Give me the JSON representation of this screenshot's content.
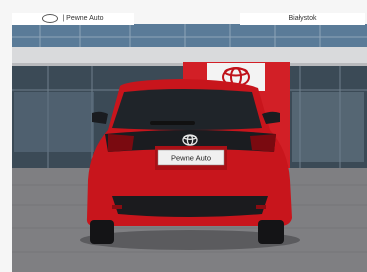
{
  "banners": {
    "left": "| Pewne Auto",
    "right": "Białystok"
  },
  "plate": {
    "text": "Pewne Auto"
  },
  "car": {
    "color": "#c8151c",
    "brand": "toyota-logo-icon"
  },
  "colors": {
    "sky": "#eaecef",
    "ground": "#7f7f82",
    "glass": "#33414d",
    "dealer_red": "#d21f26"
  }
}
